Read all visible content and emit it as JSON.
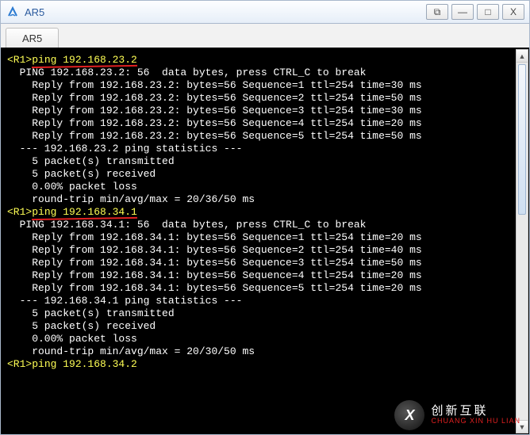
{
  "window": {
    "title": "AR5",
    "controls": {
      "popout": "⧉",
      "minimize": "—",
      "maximize": "□",
      "close": "X"
    }
  },
  "tabs": [
    {
      "label": "AR5"
    }
  ],
  "terminal": {
    "blocks": [
      {
        "prompt_host": "<R1>",
        "command": "ping 192.168.23.2",
        "underline": true,
        "output": [
          "  PING 192.168.23.2: 56  data bytes, press CTRL_C to break",
          "    Reply from 192.168.23.2: bytes=56 Sequence=1 ttl=254 time=30 ms",
          "    Reply from 192.168.23.2: bytes=56 Sequence=2 ttl=254 time=50 ms",
          "    Reply from 192.168.23.2: bytes=56 Sequence=3 ttl=254 time=30 ms",
          "    Reply from 192.168.23.2: bytes=56 Sequence=4 ttl=254 time=20 ms",
          "    Reply from 192.168.23.2: bytes=56 Sequence=5 ttl=254 time=50 ms",
          "",
          "  --- 192.168.23.2 ping statistics ---",
          "    5 packet(s) transmitted",
          "    5 packet(s) received",
          "    0.00% packet loss",
          "    round-trip min/avg/max = 20/36/50 ms",
          ""
        ]
      },
      {
        "prompt_host": "<R1>",
        "command": "ping 192.168.34.1",
        "underline": true,
        "output": [
          "  PING 192.168.34.1: 56  data bytes, press CTRL_C to break",
          "    Reply from 192.168.34.1: bytes=56 Sequence=1 ttl=254 time=20 ms",
          "    Reply from 192.168.34.1: bytes=56 Sequence=2 ttl=254 time=40 ms",
          "    Reply from 192.168.34.1: bytes=56 Sequence=3 ttl=254 time=50 ms",
          "    Reply from 192.168.34.1: bytes=56 Sequence=4 ttl=254 time=20 ms",
          "    Reply from 192.168.34.1: bytes=56 Sequence=5 ttl=254 time=20 ms",
          "",
          "  --- 192.168.34.1 ping statistics ---",
          "    5 packet(s) transmitted",
          "    5 packet(s) received",
          "    0.00% packet loss",
          "    round-trip min/avg/max = 20/30/50 ms",
          ""
        ]
      },
      {
        "prompt_host": "<R1>",
        "command": "ping 192.168.34.2",
        "underline": false,
        "output": []
      }
    ]
  },
  "watermark": {
    "logo_text": "X",
    "cn": "创新互联",
    "en": "CHUANG XIN HU LIAN"
  }
}
